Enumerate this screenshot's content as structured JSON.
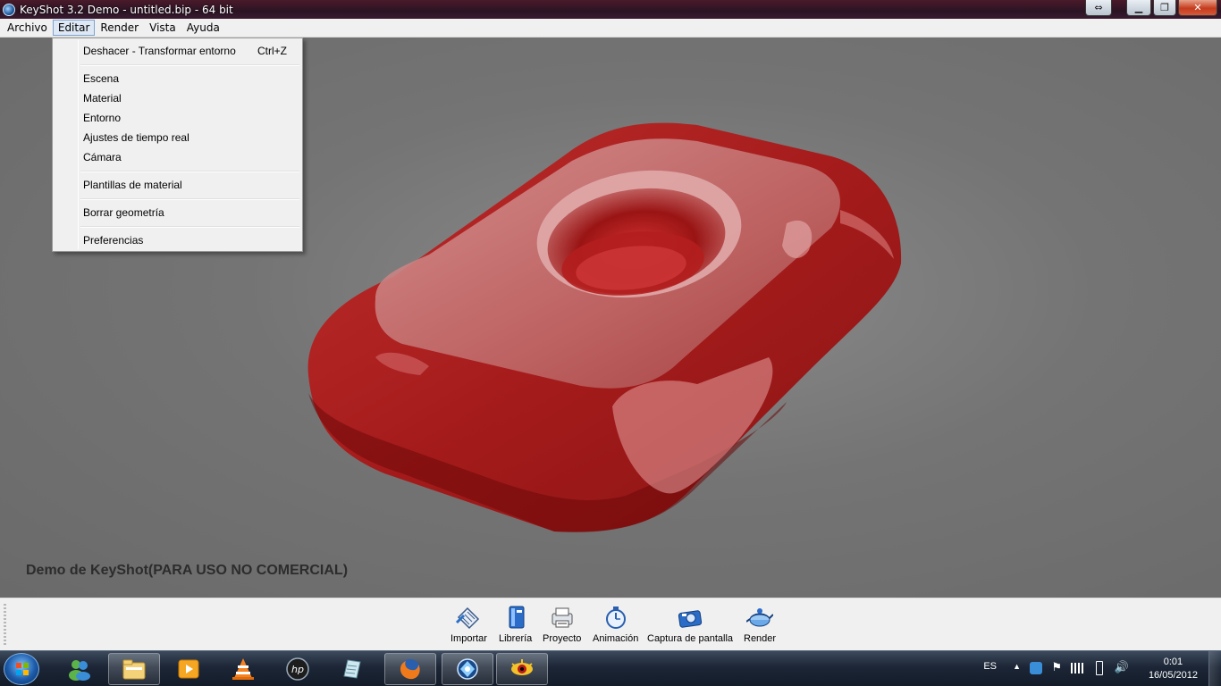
{
  "window": {
    "title": "KeyShot 3.2 Demo  - untitled.bip  - 64 bit",
    "app_icon": "keyshot-icon",
    "controls": [
      "swap-icon",
      "minimize-icon",
      "maximize-icon",
      "close-icon"
    ]
  },
  "menubar": {
    "items": [
      {
        "label": "Archivo"
      },
      {
        "label": "Editar",
        "active": true
      },
      {
        "label": "Render"
      },
      {
        "label": "Vista"
      },
      {
        "label": "Ayuda"
      }
    ]
  },
  "edit_menu": {
    "undo": {
      "label": "Deshacer - Transformar entorno",
      "shortcut": "Ctrl+Z"
    },
    "group1": [
      "Escena",
      "Material",
      "Entorno",
      "Ajustes de tiempo real",
      "Cámara"
    ],
    "material_templates": "Plantillas de material",
    "delete_geometry": "Borrar geometría",
    "preferences": "Preferencias"
  },
  "viewport": {
    "watermark": "Demo de KeyShot(PARA USO NO COMERCIAL)",
    "model_color": "#b01818",
    "background_color": "#6f6f6f"
  },
  "toolbar": {
    "buttons": [
      {
        "label": "Importar",
        "icon": "import-icon"
      },
      {
        "label": "Librería",
        "icon": "library-icon"
      },
      {
        "label": "Proyecto",
        "icon": "project-icon"
      },
      {
        "label": "Animación",
        "icon": "animation-icon"
      },
      {
        "label": "Captura de pantalla",
        "icon": "screenshot-icon"
      },
      {
        "label": "Render",
        "icon": "render-icon"
      }
    ]
  },
  "taskbar": {
    "apps": [
      "start-orb-icon",
      "messenger-icon",
      "explorer-icon",
      "media-player-icon",
      "vlc-icon",
      "hp-icon",
      "notes-icon",
      "firefox-icon",
      "keyshot-icon",
      "eye-app-icon"
    ],
    "tray": {
      "language": "ES",
      "time": "0:01",
      "date": "16/05/2012"
    }
  }
}
